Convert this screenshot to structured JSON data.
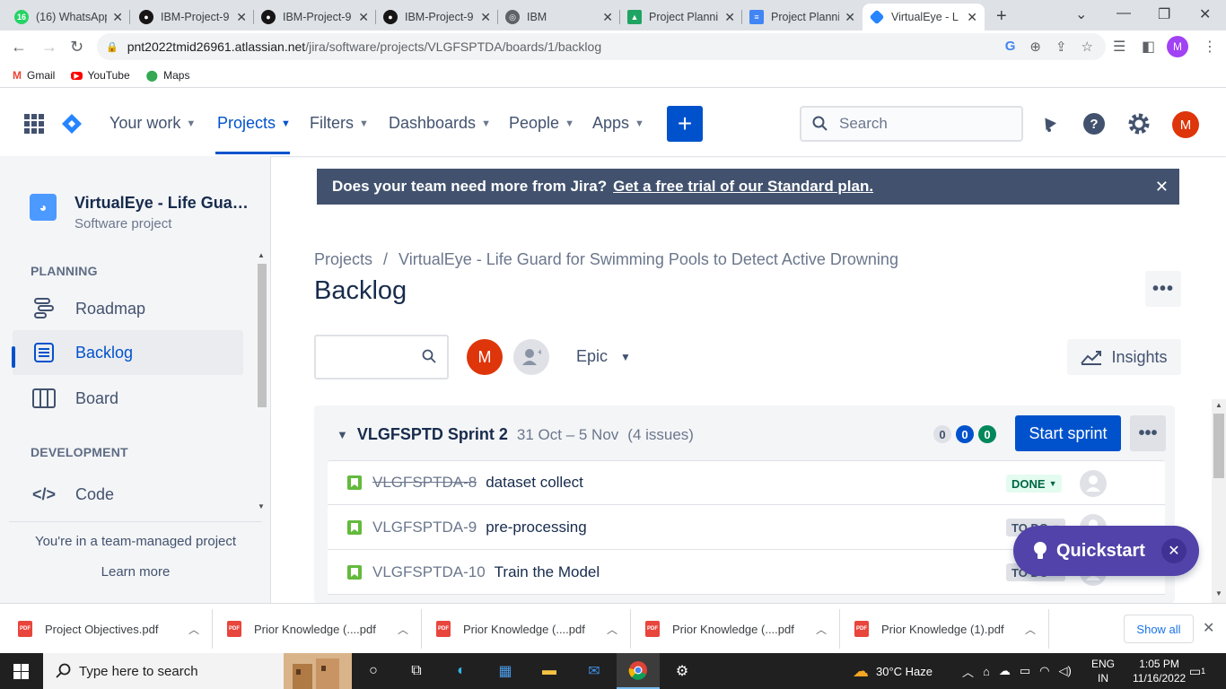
{
  "browser": {
    "tabs": [
      {
        "title": "(16) WhatsApp",
        "favicon": "whatsapp-icon",
        "color": "#25d366",
        "badge": "16"
      },
      {
        "title": "IBM-Project-9",
        "favicon": "github-icon",
        "color": "#171515"
      },
      {
        "title": "IBM-Project-9",
        "favicon": "github-icon",
        "color": "#171515"
      },
      {
        "title": "IBM-Project-9",
        "favicon": "github-icon",
        "color": "#171515"
      },
      {
        "title": "IBM",
        "favicon": "globe-icon",
        "color": "#5f6368"
      },
      {
        "title": "Project Planni",
        "favicon": "drive-icon",
        "color": "#1fa463"
      },
      {
        "title": "Project Planni",
        "favicon": "docs-icon",
        "color": "#4285f4"
      },
      {
        "title": "VirtualEye - L",
        "favicon": "jira-icon",
        "color": "#2684ff"
      }
    ],
    "url_host": "pnt2022tmid26961.atlassian.net",
    "url_path": "/jira/software/projects/VLGFSPTDA/boards/1/backlog",
    "profile_initial": "M",
    "bookmarks": [
      {
        "label": "Gmail",
        "icon": "gmail-icon"
      },
      {
        "label": "YouTube",
        "icon": "youtube-icon"
      },
      {
        "label": "Maps",
        "icon": "maps-icon"
      }
    ]
  },
  "jira_nav": {
    "items": [
      {
        "label": "Your work",
        "active": false
      },
      {
        "label": "Projects",
        "active": true
      },
      {
        "label": "Filters",
        "active": false
      },
      {
        "label": "Dashboards",
        "active": false
      },
      {
        "label": "People",
        "active": false
      },
      {
        "label": "Apps",
        "active": false
      }
    ],
    "create_label": "+",
    "search_placeholder": "Search",
    "user_initial": "M",
    "accent": "#0052cc"
  },
  "sidebar": {
    "project_name": "VirtualEye - Life Guard...",
    "project_type": "Software project",
    "planning_header": "PLANNING",
    "planning_items": [
      {
        "label": "Roadmap",
        "icon": "roadmap-icon"
      },
      {
        "label": "Backlog",
        "icon": "backlog-icon",
        "active": true
      },
      {
        "label": "Board",
        "icon": "board-icon"
      }
    ],
    "development_header": "DEVELOPMENT",
    "development_items": [
      {
        "label": "Code",
        "icon": "code-icon"
      }
    ],
    "team_text": "You're in a team-managed project",
    "learn_more": "Learn more"
  },
  "banner": {
    "text": "Does your team need more from Jira?",
    "link": "Get a free trial of our Standard plan."
  },
  "main": {
    "breadcrumb_root": "Projects",
    "breadcrumb_sep": "/",
    "breadcrumb_project": "VirtualEye - Life Guard for Swimming Pools to Detect Active Drowning",
    "title": "Backlog",
    "filter_avatar_initial": "M",
    "epic_label": "Epic",
    "insights_label": "Insights"
  },
  "sprint": {
    "name": "VLGFSPTD Sprint 2",
    "dates": "31 Oct – 5 Nov",
    "issue_count": "(4 issues)",
    "counts": [
      {
        "value": "0",
        "bg": "#dfe1e6",
        "fg": "#42526e"
      },
      {
        "value": "0",
        "bg": "#0052cc",
        "fg": "#ffffff"
      },
      {
        "value": "0",
        "bg": "#00875a",
        "fg": "#ffffff"
      }
    ],
    "start_label": "Start sprint",
    "issues": [
      {
        "key": "VLGFSPTDA-8",
        "summary": "dataset collect",
        "status": "DONE",
        "done": true
      },
      {
        "key": "VLGFSPTDA-9",
        "summary": "pre-processing",
        "status": "TO DO",
        "done": false
      },
      {
        "key": "VLGFSPTDA-10",
        "summary": "Train the Model",
        "status": "TO DO",
        "done": false
      }
    ]
  },
  "quickstart": {
    "label": "Quickstart"
  },
  "downloads": {
    "items": [
      {
        "name": "Project Objectives.pdf"
      },
      {
        "name": "Prior Knowledge (....pdf"
      },
      {
        "name": "Prior Knowledge (....pdf"
      },
      {
        "name": "Prior Knowledge (....pdf"
      },
      {
        "name": "Prior Knowledge (1).pdf"
      }
    ],
    "show_all": "Show all"
  },
  "taskbar": {
    "search_placeholder": "Type here to search",
    "weather": "30°C  Haze",
    "lang_top": "ENG",
    "lang_bottom": "IN",
    "time": "1:05 PM",
    "date": "11/16/2022",
    "notif_count": "1"
  }
}
